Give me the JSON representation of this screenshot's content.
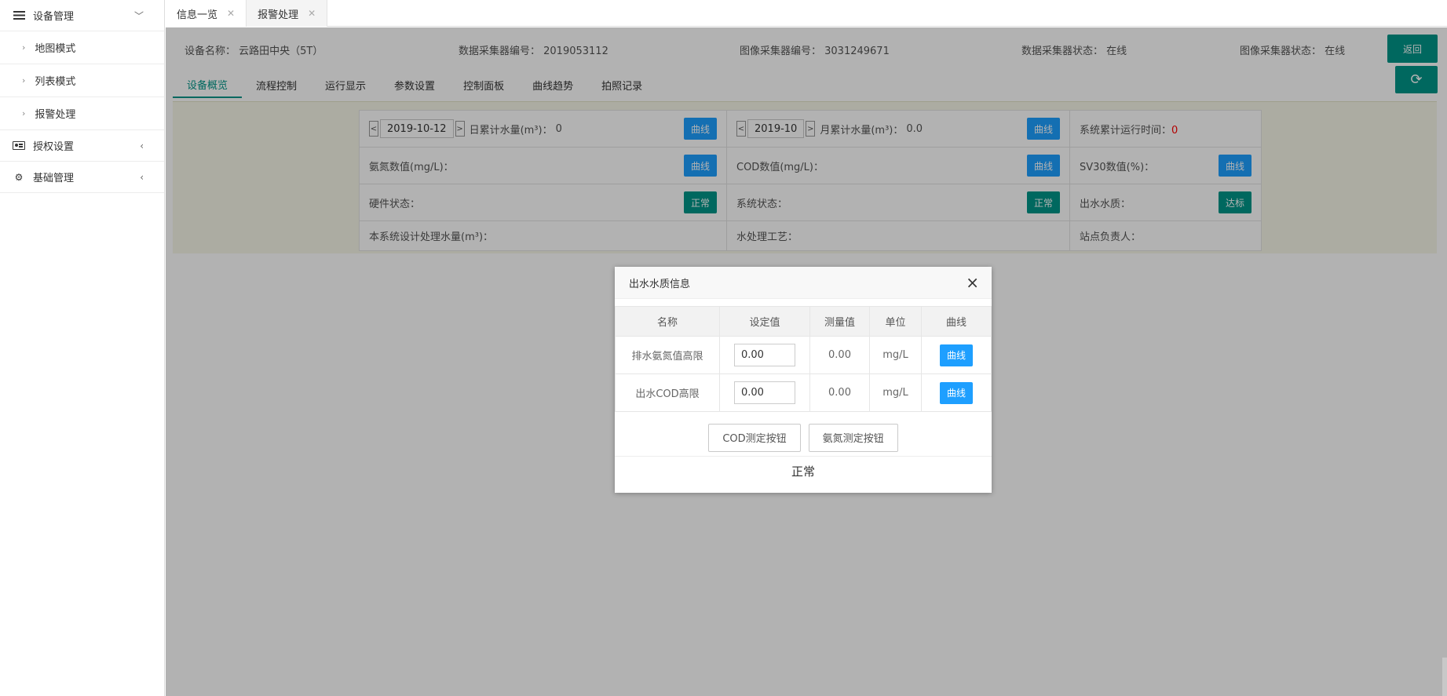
{
  "sidebar": {
    "groups": [
      {
        "label": "设备管理",
        "icon": "menu-list-icon",
        "expanded": true,
        "items": [
          {
            "label": "地图模式"
          },
          {
            "label": "列表模式"
          },
          {
            "label": "报警处理"
          }
        ]
      },
      {
        "label": "授权设置",
        "icon": "id-card-icon"
      },
      {
        "label": "基础管理",
        "icon": "gear-icon"
      }
    ]
  },
  "tabs": [
    {
      "label": "信息一览"
    },
    {
      "label": "报警处理"
    }
  ],
  "info": {
    "device_name": "设备名称： 云路田中央（5T）",
    "data_collector_id": "数据采集器编号： 2019053112",
    "image_collector_id": "图像采集器编号： 3031249671",
    "data_collector_status": "数据采集器状态： 在线",
    "image_collector_status": "图像采集器状态： 在线",
    "back_label": "返回"
  },
  "subtabs": [
    "设备概览",
    "流程控制",
    "运行显示",
    "参数设置",
    "控制面板",
    "曲线趋势",
    "拍照记录"
  ],
  "grid": {
    "daily_date": "2019-10-12",
    "daily_label": "日累计水量(m³)：",
    "daily_value": "0",
    "monthly_date": "2019-10",
    "monthly_label": "月累计水量(m³)：",
    "monthly_value": "0.0",
    "runtime_label": "系统累计运行时间：",
    "runtime_value": "0",
    "ammonia_label": "氨氮数值(mg/L)：",
    "cod_label": "COD数值(mg/L)：",
    "sv30_label": "SV30数值(%)：",
    "hardware_label": "硬件状态：",
    "hardware_status": "正常",
    "system_label": "系统状态：",
    "system_status": "正常",
    "effluent_label": "出水水质：",
    "effluent_status": "达标",
    "design_capacity_label": "本系统设计处理水量(m³)：",
    "process_label": "水处理工艺：",
    "manager_label": "站点负责人：",
    "curve_label": "曲线",
    "prev": "<",
    "next": ">"
  },
  "modal": {
    "title": "出水水质信息",
    "close": "×",
    "columns": [
      "名称",
      "设定值",
      "测量值",
      "单位",
      "曲线"
    ],
    "rows": [
      {
        "name": "排水氨氮值高限",
        "set": "0.00",
        "measured": "0.00",
        "unit": "mg/L",
        "curve": "曲线"
      },
      {
        "name": "出水COD高限",
        "set": "0.00",
        "measured": "0.00",
        "unit": "mg/L",
        "curve": "曲线"
      }
    ],
    "cod_button": "COD测定按钮",
    "ammonia_button": "氨氮测定按钮",
    "status": "正常"
  },
  "colors": {
    "accent": "#009688",
    "blue": "#1e9fff",
    "red": "#ff0000"
  }
}
